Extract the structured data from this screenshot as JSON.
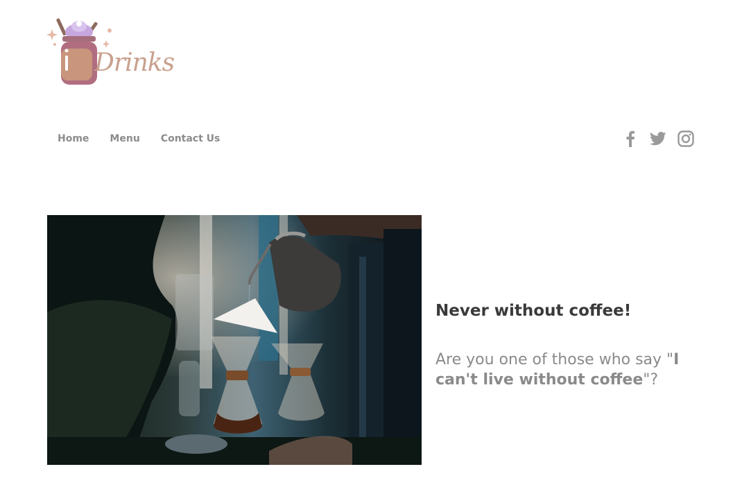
{
  "brand": {
    "logo_text": "Drinks",
    "colors": {
      "mug": "#b58a7e",
      "cream": "#c7a7e0",
      "accent": "#c9a08e"
    }
  },
  "nav": {
    "items": [
      {
        "label": "Home"
      },
      {
        "label": "Menu"
      },
      {
        "label": "Contact Us"
      }
    ]
  },
  "social": {
    "icons": [
      "facebook-icon",
      "twitter-icon",
      "instagram-icon"
    ],
    "color": "#9a9a9a"
  },
  "hero": {
    "title": "Never without coffee!",
    "body_prefix": "Are you one of those who say \"",
    "body_quote": "I can't live without coffee",
    "body_suffix": "\"?"
  }
}
